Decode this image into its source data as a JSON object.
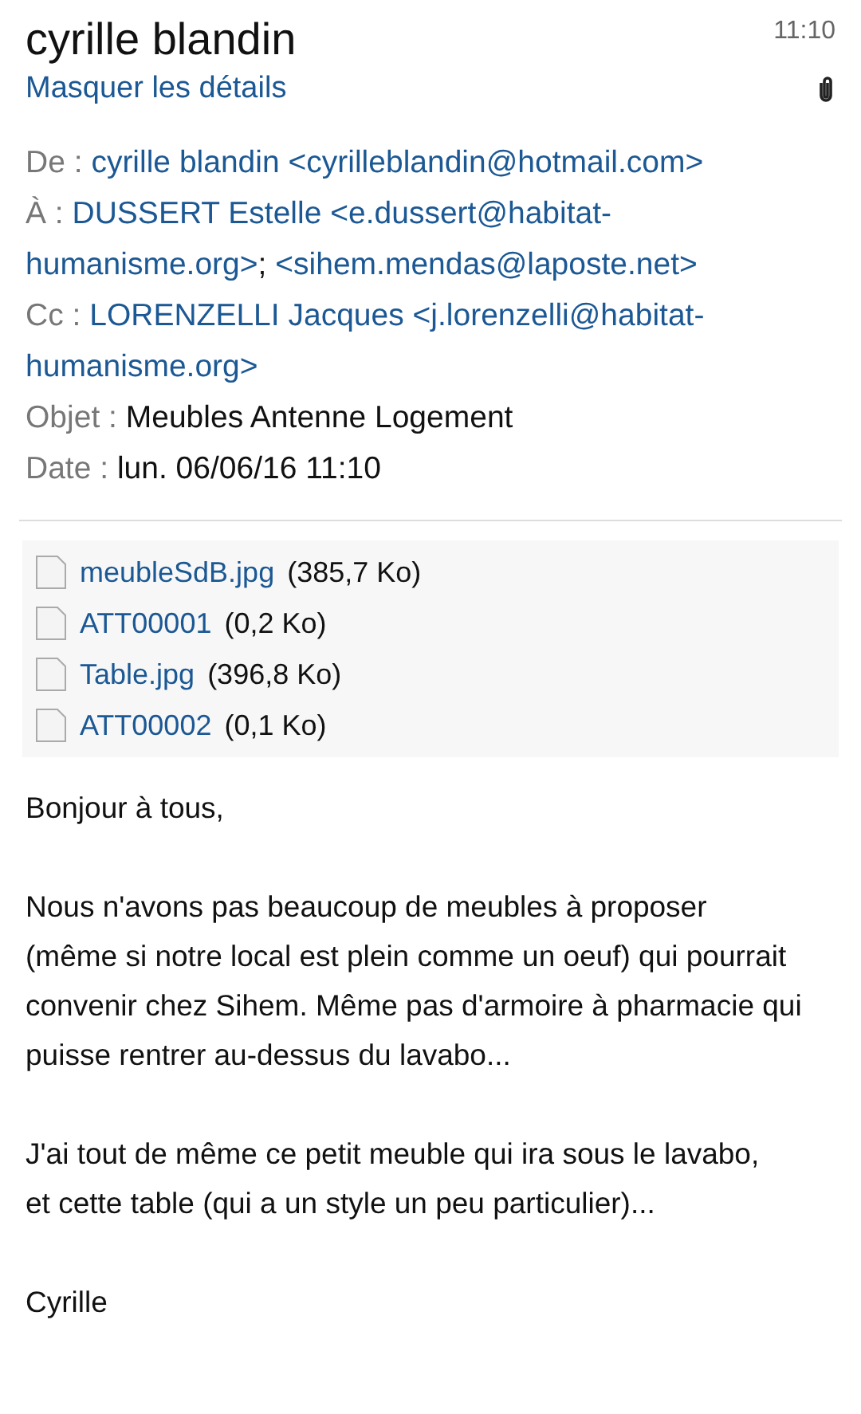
{
  "sender": "cyrille blandin",
  "time": "11:10",
  "toggle_details": "Masquer les détails",
  "has_attachment": true,
  "headers": [
    {
      "label": "De :",
      "recipients": [
        "cyrille blandin <cyrilleblandin@hotmail.com>"
      ]
    },
    {
      "label": "À :",
      "separator": ";",
      "recipients": [
        "DUSSERT Estelle <e.dussert@habitat-humanisme.org>",
        "<sihem.mendas@laposte.net>"
      ]
    },
    {
      "label": "Cc  :",
      "recipients": [
        "LORENZELLI Jacques <j.lorenzelli@habitat-humanisme.org>"
      ]
    },
    {
      "label": "Objet :",
      "value": "Meubles Antenne Logement"
    },
    {
      "label": "Date :",
      "value": "lun. 06/06/16 11:10"
    }
  ],
  "attachments": [
    {
      "name": "meubleSdB.jpg",
      "size": "(385,7 Ko)"
    },
    {
      "name": "ATT00001",
      "size": "(0,2 Ko)"
    },
    {
      "name": "Table.jpg",
      "size": "(396,8 Ko)"
    },
    {
      "name": "ATT00002",
      "size": "(0,1 Ko)"
    }
  ],
  "body": [
    [
      "Bonjour à tous,"
    ],
    [
      "Nous n'avons pas beaucoup de meubles à proposer (même si notre local est plein comme un oeuf) qui pourrait convenir chez Sihem. Même pas d'armoire à pharmacie qui puisse rentrer au-dessus du lavabo..."
    ],
    [
      "J'ai tout de même ce petit meuble qui ira sous le lavabo,",
      "et cette table (qui a un style un peu particulier)..."
    ],
    [
      "Cyrille"
    ]
  ]
}
